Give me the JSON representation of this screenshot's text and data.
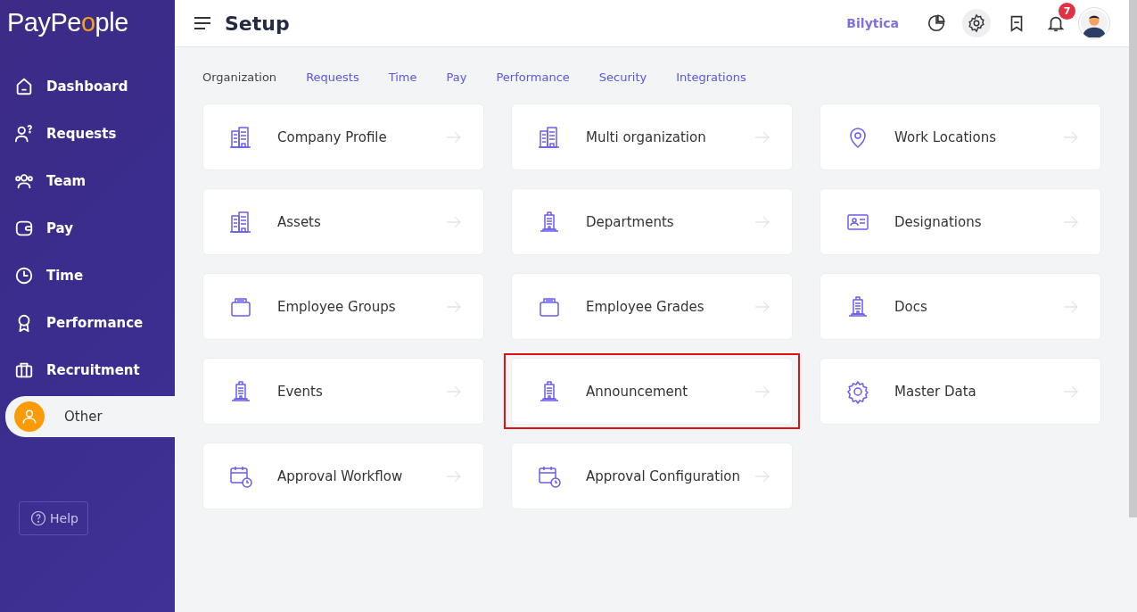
{
  "brand": {
    "logo": "PayPeople"
  },
  "sidebar": {
    "items": [
      {
        "label": "Dashboard",
        "selected": false
      },
      {
        "label": "Requests",
        "selected": false
      },
      {
        "label": "Team",
        "selected": false
      },
      {
        "label": "Pay",
        "selected": false
      },
      {
        "label": "Time",
        "selected": false
      },
      {
        "label": "Performance",
        "selected": false
      },
      {
        "label": "Recruitment",
        "selected": false
      },
      {
        "label": "Other",
        "selected": true
      }
    ],
    "help": "Help"
  },
  "header": {
    "title": "Setup",
    "company": "Bilytica",
    "notifications": "7"
  },
  "tabs": [
    {
      "label": "Organization",
      "selected": true
    },
    {
      "label": "Requests",
      "selected": false
    },
    {
      "label": "Time",
      "selected": false
    },
    {
      "label": "Pay",
      "selected": false
    },
    {
      "label": "Performance",
      "selected": false
    },
    {
      "label": "Security",
      "selected": false
    },
    {
      "label": "Integrations",
      "selected": false
    }
  ],
  "cards": [
    {
      "label": "Company Profile",
      "highlighted": false
    },
    {
      "label": "Multi organization",
      "highlighted": false
    },
    {
      "label": "Work Locations",
      "highlighted": false
    },
    {
      "label": "Assets",
      "highlighted": false
    },
    {
      "label": "Departments",
      "highlighted": false
    },
    {
      "label": "Designations",
      "highlighted": false
    },
    {
      "label": "Employee Groups",
      "highlighted": false
    },
    {
      "label": "Employee Grades",
      "highlighted": false
    },
    {
      "label": "Docs",
      "highlighted": false
    },
    {
      "label": "Events",
      "highlighted": false
    },
    {
      "label": "Announcement",
      "highlighted": true
    },
    {
      "label": "Master Data",
      "highlighted": false
    },
    {
      "label": "Approval Workflow",
      "highlighted": false
    },
    {
      "label": "Approval Configuration",
      "highlighted": false
    }
  ]
}
